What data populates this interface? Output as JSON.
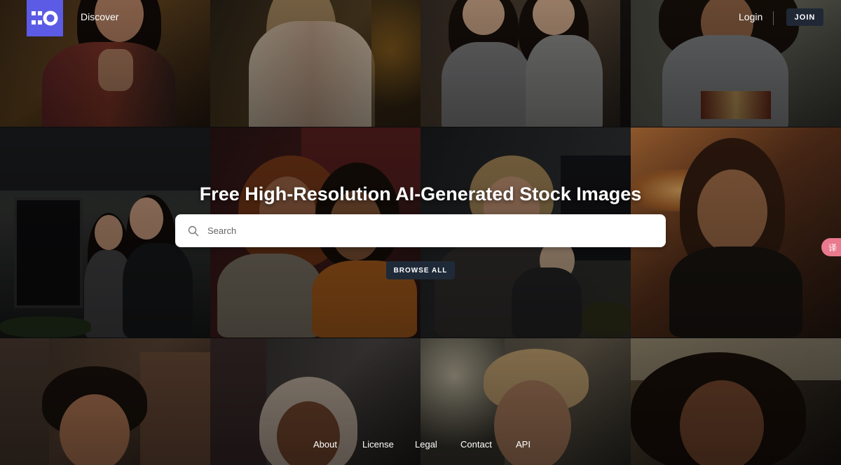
{
  "header": {
    "nav_discover": "Discover",
    "login": "Login",
    "join": "JOIN"
  },
  "hero": {
    "title": "Free High-Resolution AI-Generated Stock Images",
    "search_placeholder": "Search",
    "browse_all": "BROWSE ALL"
  },
  "footer": {
    "links": [
      "About",
      "License",
      "Legal",
      "Contact",
      "API"
    ]
  },
  "translate_icon_label": "译",
  "colors": {
    "brand": "#5b5be6",
    "dark_button": "#202835",
    "translate_badge": "#e9798d"
  }
}
